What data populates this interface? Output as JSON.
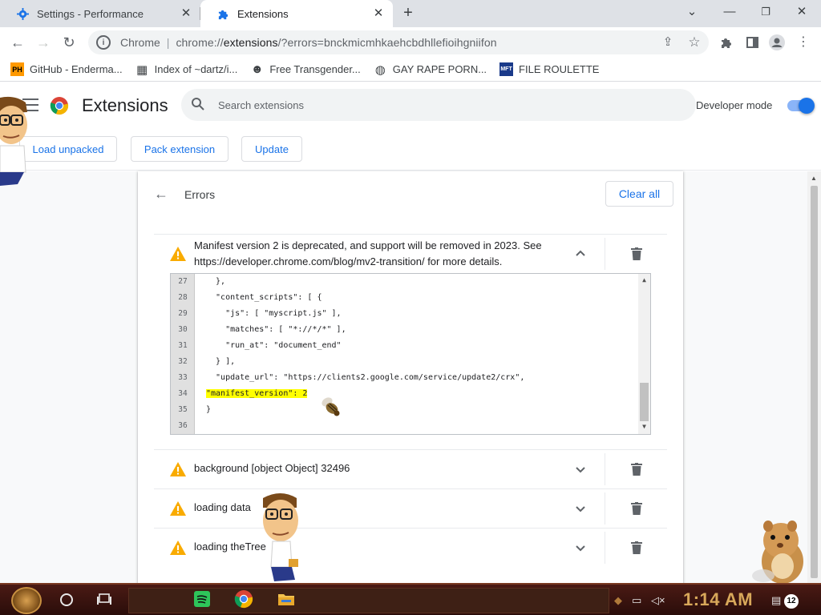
{
  "tabs": [
    {
      "title": "Settings - Performance",
      "icon": "gear-icon",
      "active": false
    },
    {
      "title": "Extensions",
      "icon": "puzzle-icon",
      "active": true
    }
  ],
  "window_controls": {
    "minimize": "—",
    "restore": "❐",
    "close": "✕",
    "tab_search": "⌄"
  },
  "toolbar": {
    "omnibox_site": "Chrome",
    "omnibox_url_prefix": "chrome://",
    "omnibox_url_host": "extensions",
    "omnibox_url_rest": "/?errors=bnckmicmhkaehcbdhllefioihgniifon"
  },
  "bookmarks": [
    {
      "label": "GitHub - Enderma...",
      "icon": "ph-icon",
      "icon_text": "PH",
      "icon_bg": "#ff9900",
      "icon_color": "#000000"
    },
    {
      "label": "Index of ~dartz/i...",
      "icon": "qr-icon",
      "icon_text": "▦",
      "icon_bg": "#ffffff",
      "icon_color": "#000000"
    },
    {
      "label": "Free Transgender...",
      "icon": "pig-icon",
      "icon_text": "☻",
      "icon_bg": "#ffffff",
      "icon_color": "#333333"
    },
    {
      "label": "GAY RAPE PORN...",
      "icon": "globe-icon",
      "icon_text": "◍",
      "icon_bg": "#ffffff",
      "icon_color": "#333333"
    },
    {
      "label": "FILE ROULETTE",
      "icon": "mft-icon",
      "icon_text": "MFT",
      "icon_bg": "#1a3a8a",
      "icon_color": "#ffffff"
    }
  ],
  "header": {
    "title": "Extensions",
    "search_placeholder": "Search extensions",
    "developer_mode_label": "Developer mode",
    "developer_mode_on": true,
    "buttons": [
      "Load unpacked",
      "Pack extension",
      "Update"
    ]
  },
  "errors_page": {
    "title": "Errors",
    "clear_all": "Clear all",
    "expanded_error": {
      "line1": "Manifest version 2 is deprecated, and support will be removed in 2023. See",
      "line2": "https://developer.chrome.com/blog/mv2-transition/ for more details."
    },
    "code_lines": [
      {
        "n": "27",
        "text": "  },",
        "highlight": false
      },
      {
        "n": "28",
        "text": "  \"content_scripts\": [ {",
        "highlight": false
      },
      {
        "n": "29",
        "text": "    \"js\": [ \"myscript.js\" ],",
        "highlight": false
      },
      {
        "n": "30",
        "text": "    \"matches\": [ \"*://*/*\" ],",
        "highlight": false
      },
      {
        "n": "31",
        "text": "    \"run_at\": \"document_end\"",
        "highlight": false
      },
      {
        "n": "32",
        "text": "  } ],",
        "highlight": false
      },
      {
        "n": "33",
        "text": "  \"update_url\": \"https://clients2.google.com/service/update2/crx\",",
        "highlight": false
      },
      {
        "n": "34",
        "text": "\"manifest_version\": 2",
        "highlight": true
      },
      {
        "n": "35",
        "text": "}",
        "highlight": false
      },
      {
        "n": "36",
        "text": "",
        "highlight": false
      }
    ],
    "collapsed_errors": [
      "background [object Object] 32496",
      "loading data",
      "loading theTree"
    ]
  },
  "taskbar": {
    "time": "1:14 AM",
    "notification_count": "12"
  },
  "colors": {
    "accent": "#1a73e8",
    "warning": "#f9ab00",
    "highlight": "#ffff00",
    "taskbar": "#3a120d",
    "clock": "#d8a85a"
  }
}
